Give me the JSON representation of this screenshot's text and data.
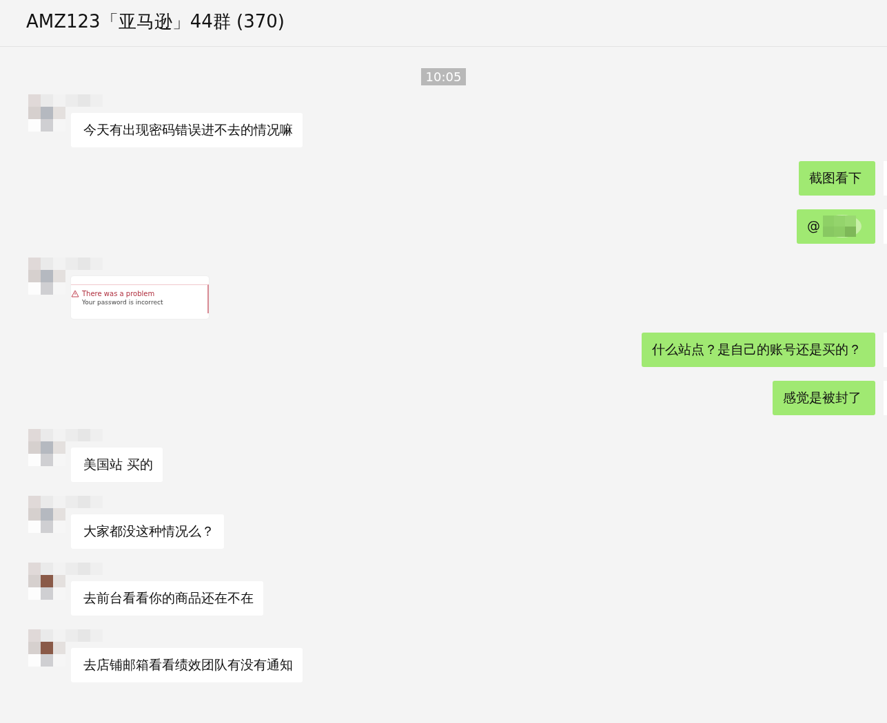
{
  "window": {
    "title": "AMZ123「亚马逊」44群 (370)"
  },
  "messages": [
    {
      "kind": "time",
      "text": "10:05"
    },
    {
      "kind": "text",
      "outgoing": false,
      "color": "#b5b9c0",
      "text": "今天有出现密码错误进不去的情况嘛"
    },
    {
      "kind": "text",
      "outgoing": true,
      "text": "截图看下"
    },
    {
      "kind": "mention",
      "outgoing": true,
      "text": "@"
    },
    {
      "kind": "image",
      "outgoing": false,
      "color": "#b5b9c0",
      "title": "There was a problem",
      "detail": "Your password is incorrect"
    },
    {
      "kind": "text",
      "outgoing": true,
      "text": "什么站点？是自己的账号还是买的？"
    },
    {
      "kind": "text",
      "outgoing": true,
      "text": "感觉是被封了"
    },
    {
      "kind": "text",
      "outgoing": false,
      "color": "#b5b9c0",
      "text": "美国站 买的"
    },
    {
      "kind": "text",
      "outgoing": false,
      "color": "#b5b9c0",
      "text": "大家都没这种情况么？"
    },
    {
      "kind": "text",
      "outgoing": false,
      "color": "#8a5a48",
      "text": "去前台看看你的商品还在不在"
    },
    {
      "kind": "text",
      "outgoing": false,
      "color": "#8a5a48",
      "text": "去店铺邮箱看看绩效团队有没有通知"
    }
  ]
}
